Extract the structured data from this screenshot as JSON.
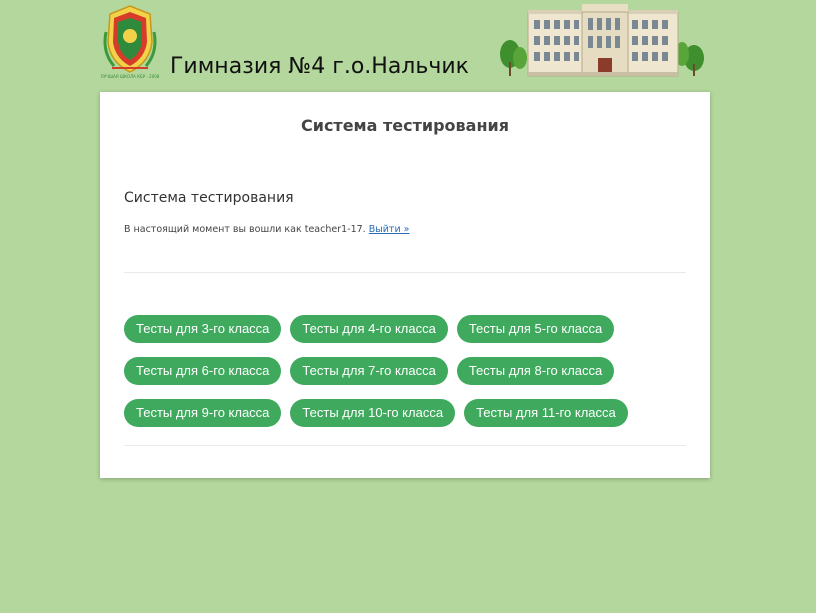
{
  "header": {
    "site_title": "Гимназия №4 г.о.Нальчик",
    "logo_caption": "ЛУЧШАЯ ШКОЛА КБР - 2008"
  },
  "card": {
    "title": "Система тестирования",
    "section_title": "Система тестирования",
    "login_prefix": "В настоящий момент вы вошли как teacher1-17.",
    "logout_link": "Выйти »"
  },
  "tests": {
    "rows": [
      [
        "Тесты для 3-го класса",
        "Тесты для 4-го класса",
        "Тесты для 5-го класса"
      ],
      [
        "Тесты для 6-го класса",
        "Тесты для 7-го класса",
        "Тесты для 8-го класса"
      ],
      [
        "Тесты для 9-го класса",
        "Тесты для 10-го класса",
        "Тесты для 11-го класса"
      ]
    ]
  },
  "colors": {
    "background": "#b3d79c",
    "button": "#3faa5e",
    "link": "#2a6db8"
  }
}
